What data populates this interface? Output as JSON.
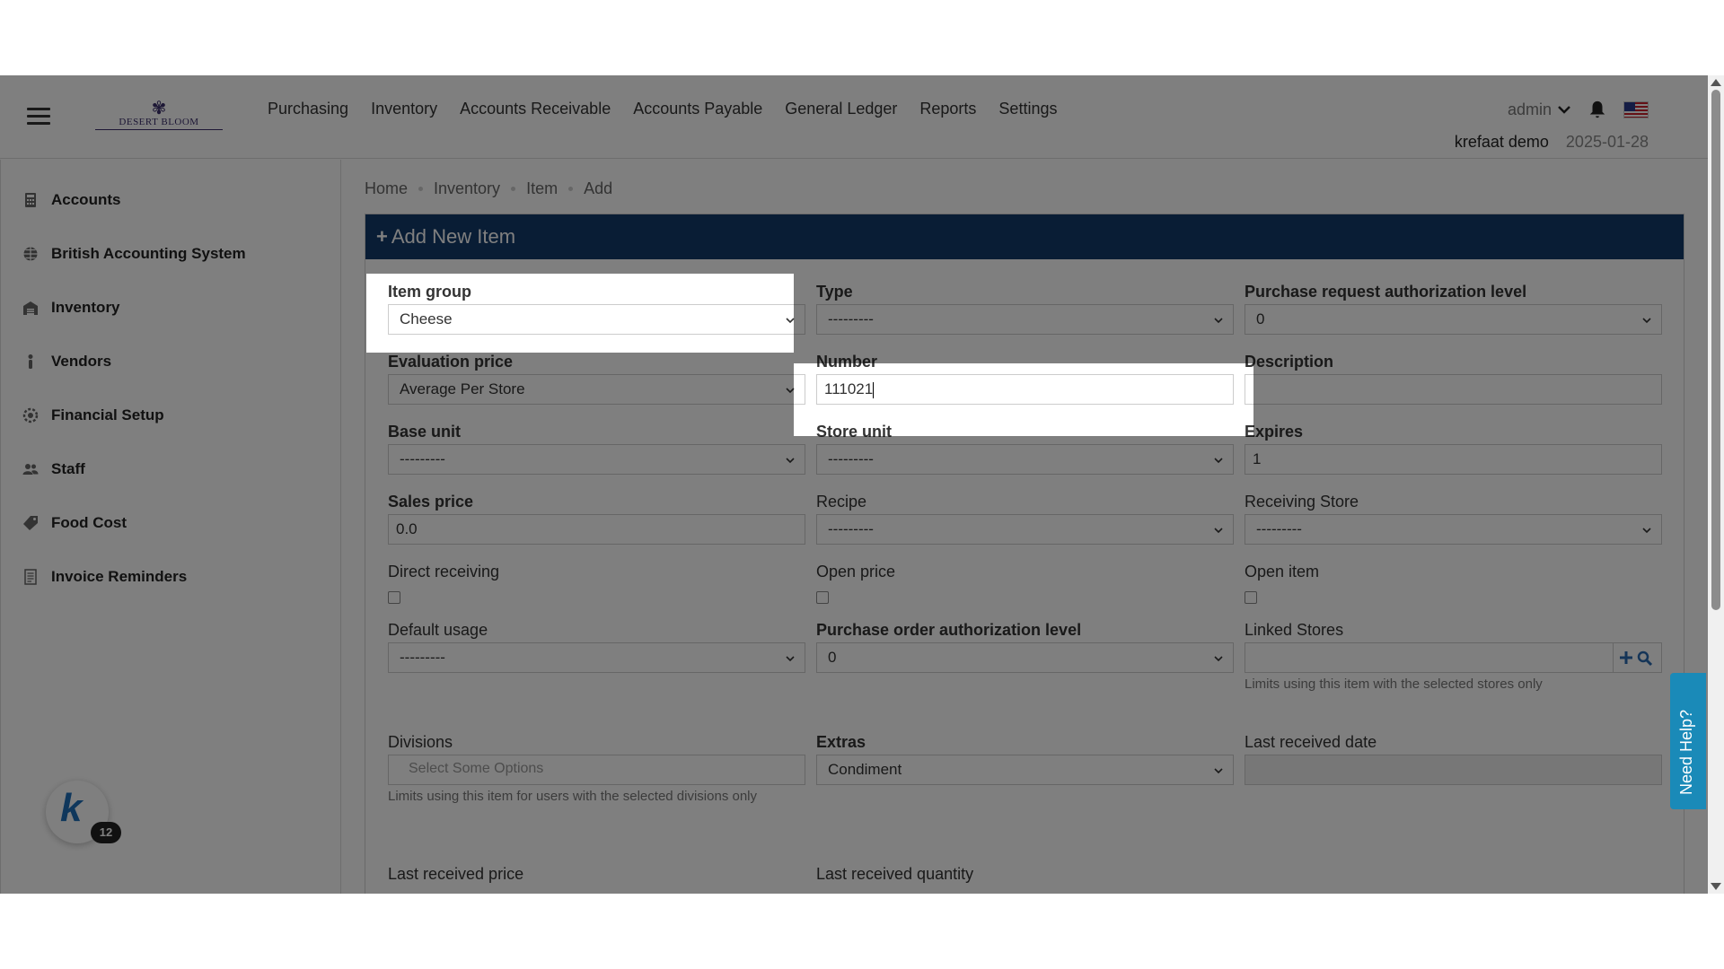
{
  "header": {
    "logo_text": "DESERT BLOOM",
    "nav": [
      "Purchasing",
      "Inventory",
      "Accounts Receivable",
      "Accounts Payable",
      "General Ledger",
      "Reports",
      "Settings"
    ],
    "user": "admin",
    "company": "krefaat demo",
    "date": "2025-01-28"
  },
  "sidebar": {
    "items": [
      {
        "label": "Accounts",
        "icon": "calculator-icon"
      },
      {
        "label": "British Accounting System",
        "icon": "globe-icon"
      },
      {
        "label": "Inventory",
        "icon": "warehouse-icon"
      },
      {
        "label": "Vendors",
        "icon": "person-icon"
      },
      {
        "label": "Financial Setup",
        "icon": "gear-icon"
      },
      {
        "label": "Staff",
        "icon": "people-icon"
      },
      {
        "label": "Food Cost",
        "icon": "tag-icon"
      },
      {
        "label": "Invoice Reminders",
        "icon": "document-icon"
      }
    ],
    "badge_count": "12"
  },
  "breadcrumb": [
    "Home",
    "Inventory",
    "Item",
    "Add"
  ],
  "panel_title": "Add New Item",
  "form": {
    "item_group": {
      "label": "Item group",
      "value": "Cheese"
    },
    "type": {
      "label": "Type",
      "value": "---------"
    },
    "pr_auth_level": {
      "label": "Purchase request authorization level",
      "value": "0"
    },
    "evaluation_price": {
      "label": "Evaluation price",
      "value": "Average Per Store"
    },
    "number": {
      "label": "Number",
      "value": "111021"
    },
    "description": {
      "label": "Description",
      "value": ""
    },
    "base_unit": {
      "label": "Base unit",
      "value": "---------"
    },
    "store_unit": {
      "label": "Store unit",
      "value": "---------"
    },
    "expires": {
      "label": "Expires",
      "value": "1"
    },
    "sales_price": {
      "label": "Sales price",
      "value": "0.0"
    },
    "recipe": {
      "label": "Recipe",
      "value": "---------"
    },
    "receiving_store": {
      "label": "Receiving Store",
      "value": "---------"
    },
    "direct_receiving": {
      "label": "Direct receiving"
    },
    "open_price": {
      "label": "Open price"
    },
    "open_item": {
      "label": "Open item"
    },
    "default_usage": {
      "label": "Default usage",
      "value": "---------"
    },
    "po_auth_level": {
      "label": "Purchase order authorization level",
      "value": "0"
    },
    "linked_stores": {
      "label": "Linked Stores",
      "hint": "Limits using this item with the selected stores only"
    },
    "divisions": {
      "label": "Divisions",
      "placeholder": "Select Some Options",
      "hint": "Limits using this item for users with the selected divisions only"
    },
    "extras": {
      "label": "Extras",
      "value": "Condiment"
    },
    "last_received_date": {
      "label": "Last received date",
      "value": ""
    },
    "last_received_price": {
      "label": "Last received price"
    },
    "last_received_quantity": {
      "label": "Last received quantity"
    }
  },
  "help_tab": "Need Help?"
}
